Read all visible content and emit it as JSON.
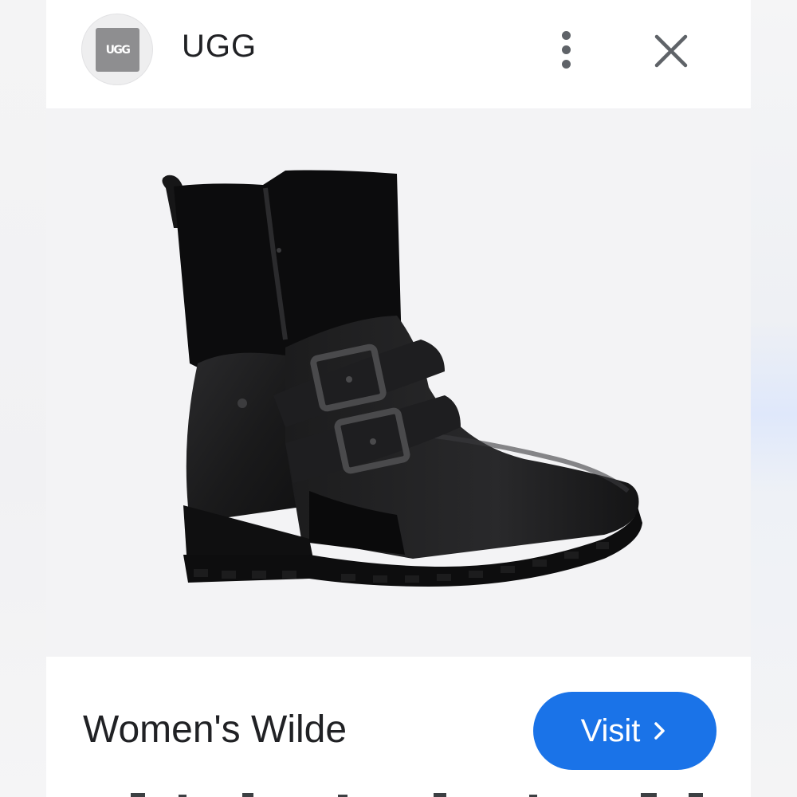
{
  "header": {
    "logo_text": "UGG",
    "brand_name": "UGG",
    "menu_icon": "more-vert-icon",
    "close_icon": "close-icon"
  },
  "product": {
    "image_description": "black-leather-boot-with-two-buckles",
    "title": "Women's Wilde"
  },
  "actions": {
    "visit_label": "Visit",
    "visit_icon": "chevron-right-icon"
  },
  "colors": {
    "accent": "#1a73e8",
    "text": "#202124",
    "icon": "#5f6368",
    "logo_bg": "#8e8e90"
  }
}
